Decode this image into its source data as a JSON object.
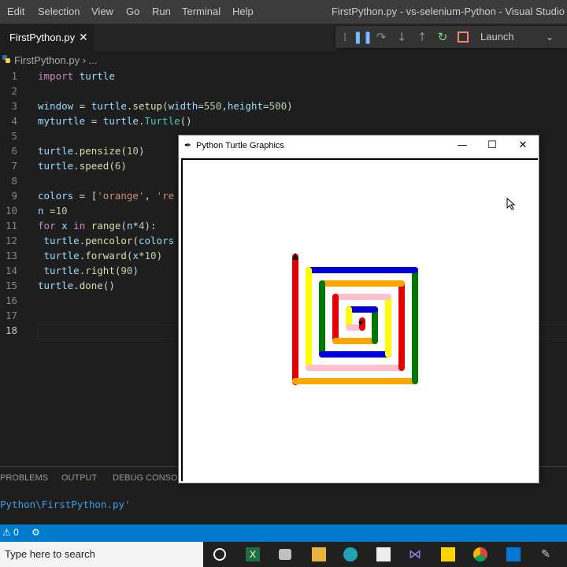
{
  "menubar": {
    "items": [
      "Edit",
      "Selection",
      "View",
      "Go",
      "Run",
      "Terminal",
      "Help"
    ],
    "title": "FirstPython.py - vs-selenium-Python - Visual Studio Code"
  },
  "tab": {
    "label": "FirstPython.py",
    "close": "✕"
  },
  "debug": {
    "launch_label": "Launch"
  },
  "breadcrumb": {
    "file": "FirstPython.py",
    "more": "..."
  },
  "editor": {
    "active_line": 18,
    "lines": [
      {
        "n": "1",
        "tokens": [
          [
            "kw",
            "import"
          ],
          [
            "plain",
            " "
          ],
          [
            "var",
            "turtle"
          ]
        ]
      },
      {
        "n": "2",
        "tokens": []
      },
      {
        "n": "3",
        "tokens": [
          [
            "var",
            "window"
          ],
          [
            "plain",
            " = "
          ],
          [
            "var",
            "turtle"
          ],
          [
            "plain",
            "."
          ],
          [
            "fn",
            "setup"
          ],
          [
            "plain",
            "("
          ],
          [
            "var",
            "width"
          ],
          [
            "plain",
            "="
          ],
          [
            "num",
            "550"
          ],
          [
            "plain",
            ","
          ],
          [
            "var",
            "height"
          ],
          [
            "plain",
            "="
          ],
          [
            "num",
            "500"
          ],
          [
            "plain",
            ")"
          ]
        ]
      },
      {
        "n": "4",
        "tokens": [
          [
            "var",
            "myturtle"
          ],
          [
            "plain",
            " = "
          ],
          [
            "var",
            "turtle"
          ],
          [
            "plain",
            "."
          ],
          [
            "cls",
            "Turtle"
          ],
          [
            "plain",
            "()"
          ]
        ]
      },
      {
        "n": "5",
        "tokens": []
      },
      {
        "n": "6",
        "tokens": [
          [
            "var",
            "turtle"
          ],
          [
            "plain",
            "."
          ],
          [
            "fn",
            "pensize"
          ],
          [
            "plain",
            "("
          ],
          [
            "num",
            "10"
          ],
          [
            "plain",
            ")"
          ]
        ]
      },
      {
        "n": "7",
        "tokens": [
          [
            "var",
            "turtle"
          ],
          [
            "plain",
            "."
          ],
          [
            "fn",
            "speed"
          ],
          [
            "plain",
            "("
          ],
          [
            "num",
            "6"
          ],
          [
            "plain",
            ")"
          ]
        ]
      },
      {
        "n": "8",
        "tokens": []
      },
      {
        "n": "9",
        "tokens": [
          [
            "var",
            "colors"
          ],
          [
            "plain",
            " = ["
          ],
          [
            "str",
            "'orange'"
          ],
          [
            "plain",
            ", "
          ],
          [
            "str",
            "'re"
          ]
        ]
      },
      {
        "n": "10",
        "tokens": [
          [
            "var",
            "n"
          ],
          [
            "plain",
            " ="
          ],
          [
            "num",
            "10"
          ]
        ]
      },
      {
        "n": "11",
        "tokens": [
          [
            "kw",
            "for"
          ],
          [
            "plain",
            " "
          ],
          [
            "var",
            "x"
          ],
          [
            "plain",
            " "
          ],
          [
            "kw",
            "in"
          ],
          [
            "plain",
            " "
          ],
          [
            "fn",
            "range"
          ],
          [
            "plain",
            "("
          ],
          [
            "var",
            "n"
          ],
          [
            "plain",
            "*"
          ],
          [
            "num",
            "4"
          ],
          [
            "plain",
            "):"
          ]
        ]
      },
      {
        "n": "12",
        "tokens": [
          [
            "plain",
            " "
          ],
          [
            "var",
            "turtle"
          ],
          [
            "plain",
            "."
          ],
          [
            "fn",
            "pencolor"
          ],
          [
            "plain",
            "("
          ],
          [
            "var",
            "colors"
          ]
        ]
      },
      {
        "n": "13",
        "tokens": [
          [
            "plain",
            " "
          ],
          [
            "var",
            "turtle"
          ],
          [
            "plain",
            "."
          ],
          [
            "fn",
            "forward"
          ],
          [
            "plain",
            "("
          ],
          [
            "var",
            "x"
          ],
          [
            "plain",
            "*"
          ],
          [
            "num",
            "10"
          ],
          [
            "plain",
            ")"
          ]
        ]
      },
      {
        "n": "14",
        "tokens": [
          [
            "plain",
            " "
          ],
          [
            "var",
            "turtle"
          ],
          [
            "plain",
            "."
          ],
          [
            "fn",
            "right"
          ],
          [
            "plain",
            "("
          ],
          [
            "num",
            "90"
          ],
          [
            "plain",
            ")"
          ]
        ]
      },
      {
        "n": "15",
        "tokens": [
          [
            "var",
            "turtle"
          ],
          [
            "plain",
            "."
          ],
          [
            "fn",
            "done"
          ],
          [
            "plain",
            "()"
          ]
        ]
      },
      {
        "n": "16",
        "tokens": []
      },
      {
        "n": "17",
        "tokens": []
      },
      {
        "n": "18",
        "tokens": []
      }
    ]
  },
  "panel": {
    "tabs": [
      "PROBLEMS",
      "OUTPUT",
      "DEBUG CONSOLE"
    ],
    "path": "Python\\FirstPython.py'"
  },
  "statusbar": {
    "warnings": "⚠ 0"
  },
  "taskbar": {
    "search_placeholder": "Type here to search"
  },
  "turtle_window": {
    "title": "Python Turtle Graphics",
    "minimize": "—",
    "maximize": "☐",
    "close": "✕",
    "drawing": {
      "step": 10,
      "iterations": 40,
      "pen_colors_visible": [
        "red",
        "yellow",
        "green",
        "orange",
        "blue",
        "pink"
      ]
    }
  },
  "colors": {
    "accent": "#007acc",
    "red": "#e60000",
    "yellow": "#ffff00",
    "green": "#007700",
    "orange": "#ffa500",
    "blue": "#0000dd",
    "pink": "#ffc0cb"
  }
}
